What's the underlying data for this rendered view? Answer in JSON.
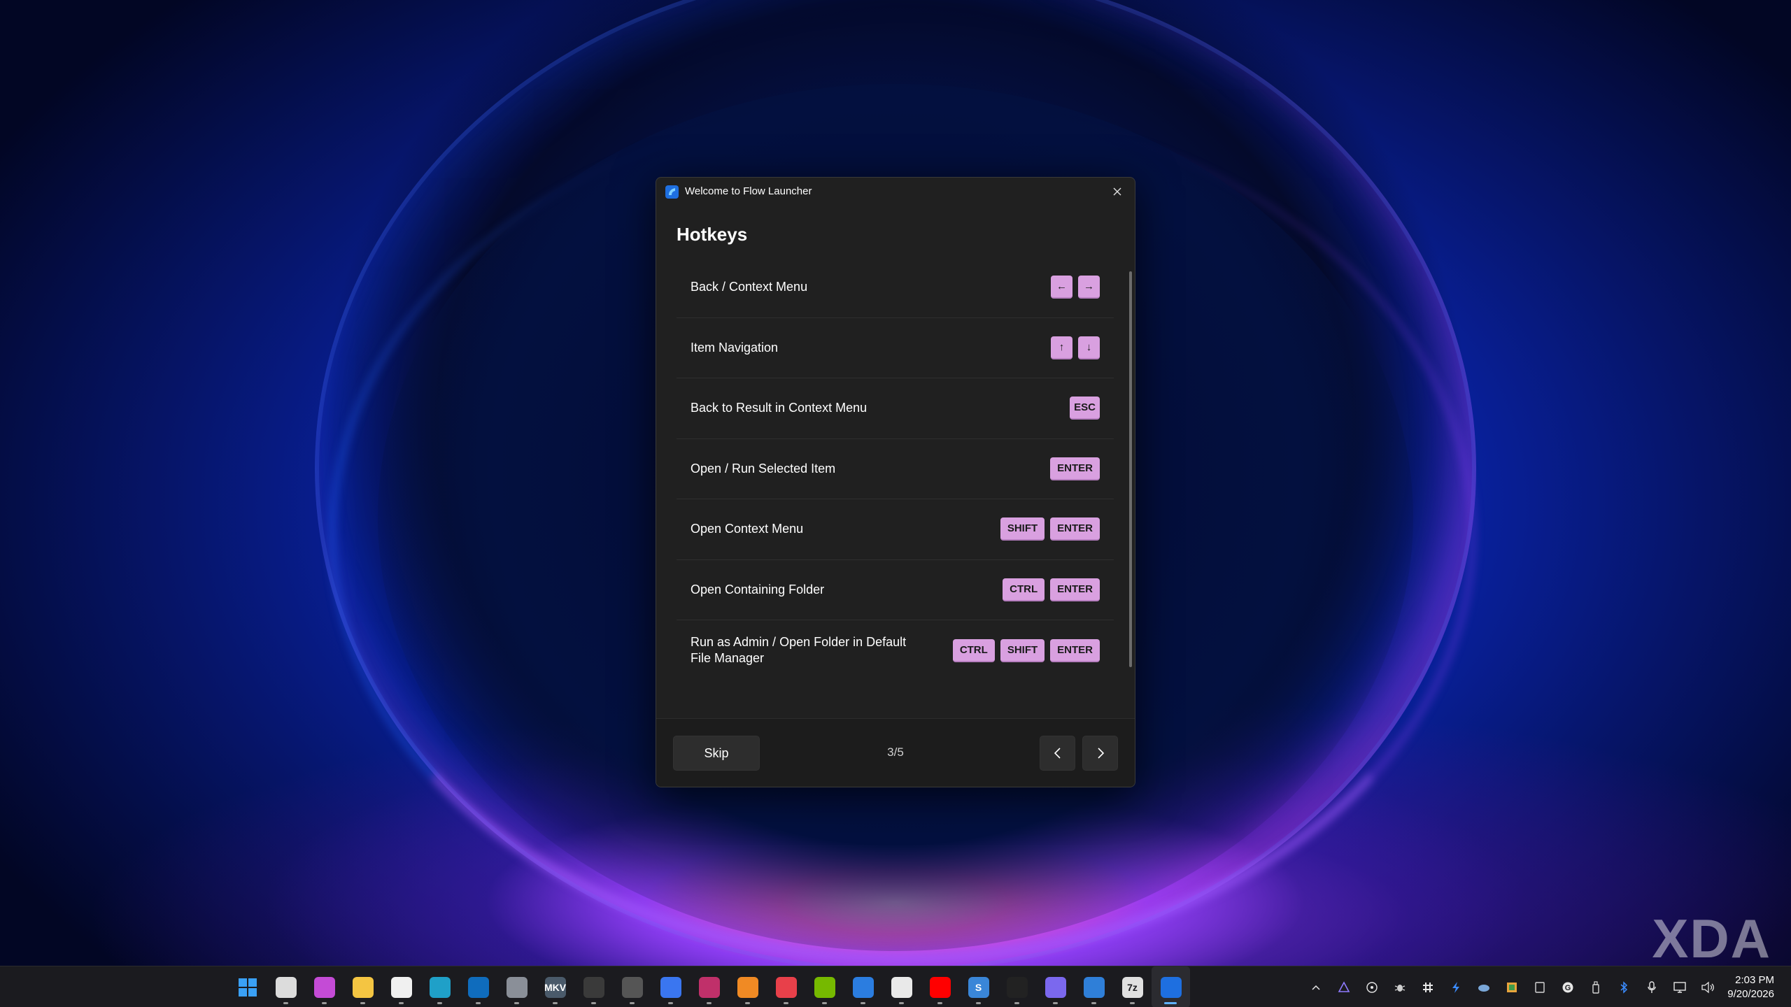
{
  "dialog": {
    "title": "Welcome to Flow Launcher",
    "heading": "Hotkeys",
    "hotkeys": [
      {
        "label": "Back / Context Menu",
        "keys": [
          "←",
          "→"
        ]
      },
      {
        "label": "Item Navigation",
        "keys": [
          "↑",
          "↓"
        ]
      },
      {
        "label": "Back to Result in Context Menu",
        "keys": [
          "ESC"
        ]
      },
      {
        "label": "Open / Run Selected Item",
        "keys": [
          "ENTER"
        ]
      },
      {
        "label": "Open Context Menu",
        "keys": [
          "SHIFT",
          "ENTER"
        ]
      },
      {
        "label": "Open Containing Folder",
        "keys": [
          "CTRL",
          "ENTER"
        ]
      },
      {
        "label": "Run as Admin / Open Folder in Default File Manager",
        "keys": [
          "CTRL",
          "SHIFT",
          "ENTER"
        ]
      }
    ],
    "footer": {
      "skip_label": "Skip",
      "page_indicator": "3/5"
    }
  },
  "colors": {
    "key_background": "#d9a0e0",
    "dialog_background": "#202020",
    "accent": "#5fb2ff"
  },
  "taskbar": {
    "apps": [
      {
        "name": "start-icon",
        "glyph": "",
        "color": "#2f8cf0"
      },
      {
        "name": "task-view-icon",
        "glyph": "",
        "color": "#dcdcdc"
      },
      {
        "name": "copilot-icon",
        "glyph": "",
        "color": "#c44bd6"
      },
      {
        "name": "file-explorer-icon",
        "glyph": "",
        "color": "#f4c542"
      },
      {
        "name": "microsoft-store-icon",
        "glyph": "",
        "color": "#f0f0f0"
      },
      {
        "name": "edge-icon",
        "glyph": "",
        "color": "#1fa0c8"
      },
      {
        "name": "outlook-icon",
        "glyph": "",
        "color": "#0f6cbd"
      },
      {
        "name": "settings-icon",
        "glyph": "",
        "color": "#8a8f98"
      },
      {
        "name": "mkv-icon",
        "glyph": "MKV",
        "color": "#4a5a6a"
      },
      {
        "name": "obs-icon",
        "glyph": "",
        "color": "#3a3a3a"
      },
      {
        "name": "bug-app-icon",
        "glyph": "",
        "color": "#555555"
      },
      {
        "name": "signal-icon",
        "glyph": "",
        "color": "#3a76f0"
      },
      {
        "name": "headset-app-icon",
        "glyph": "",
        "color": "#c0306a"
      },
      {
        "name": "search-app-icon",
        "glyph": "",
        "color": "#f08a24"
      },
      {
        "name": "dots-app-icon",
        "glyph": "",
        "color": "#e8404a"
      },
      {
        "name": "nvidia-icon",
        "glyph": "",
        "color": "#76b900"
      },
      {
        "name": "photos-icon",
        "glyph": "",
        "color": "#2b7de0"
      },
      {
        "name": "slack-icon",
        "glyph": "",
        "color": "#e9e9e9"
      },
      {
        "name": "youtube-icon",
        "glyph": "",
        "color": "#ff0000"
      },
      {
        "name": "simplenote-icon",
        "glyph": "S",
        "color": "#3a86d8"
      },
      {
        "name": "affinity-icon",
        "glyph": "",
        "color": "#222222"
      },
      {
        "name": "teams-icon",
        "glyph": "",
        "color": "#7b68ee"
      },
      {
        "name": "whiteboard-icon",
        "glyph": "",
        "color": "#2f7fd8"
      },
      {
        "name": "7zip-icon",
        "glyph": "7z",
        "color": "#e0e0e0"
      },
      {
        "name": "flow-launcher-icon",
        "glyph": "",
        "color": "#1e6fe0"
      }
    ],
    "clock_time": "2:03 PM",
    "clock_date": "9/20/2026"
  },
  "watermark": "XDA"
}
